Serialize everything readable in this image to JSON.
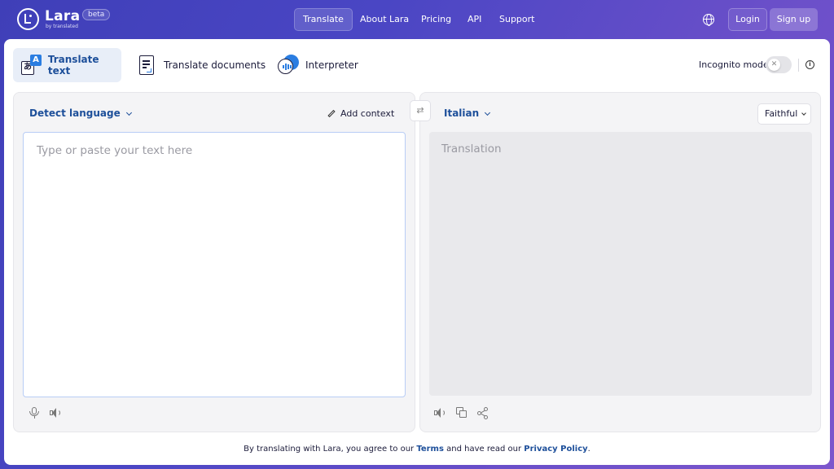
{
  "header": {
    "brand": "Lara",
    "brand_sub": "by translated",
    "beta": "beta",
    "nav": [
      "Translate",
      "About Lara",
      "Pricing",
      "API",
      "Support"
    ],
    "login": "Login",
    "signup": "Sign up",
    "language_icon": "globe-icon"
  },
  "tabs": [
    {
      "label": "Translate text",
      "icon": "translate-text-icon",
      "active": true
    },
    {
      "label": "Translate documents",
      "icon": "document-icon",
      "active": false
    },
    {
      "label": "Interpreter",
      "icon": "interpreter-icon",
      "active": false
    }
  ],
  "incognito": {
    "label": "Incognito mode",
    "enabled": false
  },
  "source": {
    "language": "Detect language",
    "add_context": "Add context",
    "placeholder": "Type or paste your text here"
  },
  "target": {
    "language": "Italian",
    "style": "Faithful",
    "placeholder": "Translation"
  },
  "footer": {
    "prefix": "By translating with Lara, you agree to our ",
    "terms": "Terms",
    "middle": " and have read our ",
    "privacy": "Privacy Policy",
    "suffix": "."
  },
  "colors": {
    "accent": "#1d4f9a",
    "icon_blue": "#2a7de1",
    "header_gradient_start": "#3f3fb8",
    "header_gradient_end": "#7c56cc"
  }
}
